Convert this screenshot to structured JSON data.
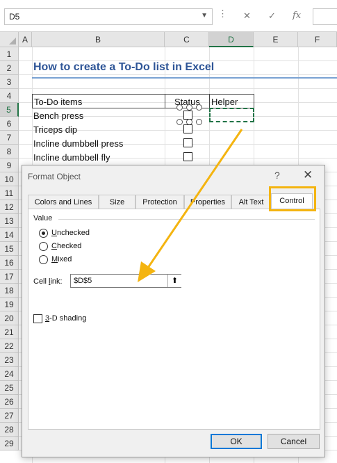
{
  "formula_bar": {
    "name_box": "D5",
    "cancel_glyph": "✕",
    "enter_glyph": "✓",
    "fx_glyph": "fx"
  },
  "columns": [
    "A",
    "B",
    "C",
    "D",
    "E",
    "F"
  ],
  "selected_column": "D",
  "rows": [
    "1",
    "2",
    "3",
    "4",
    "5",
    "6",
    "7",
    "8",
    "9",
    "10",
    "11",
    "12",
    "13",
    "14",
    "15",
    "16",
    "17",
    "18",
    "19",
    "20",
    "21",
    "22",
    "23",
    "24",
    "25",
    "26",
    "27",
    "28",
    "29"
  ],
  "selected_row": "5",
  "sheet": {
    "title": "How to create a To-Do list in Excel",
    "headers": {
      "items": "To-Do items",
      "status": "Status",
      "helper": "Helper"
    },
    "items": [
      "Bench press",
      "Triceps dip",
      "Incline dumbbell press",
      "Incline dumbbell fly"
    ]
  },
  "dialog": {
    "title": "Format Object",
    "help_glyph": "?",
    "close_glyph": "✕",
    "tabs": [
      "Colors and Lines",
      "Size",
      "Protection",
      "Properties",
      "Alt Text",
      "Control"
    ],
    "active_tab": "Control",
    "value_group_label": "Value",
    "radio_options": [
      {
        "first": "U",
        "rest": "nchecked",
        "selected": true
      },
      {
        "first": "C",
        "rest": "hecked",
        "selected": false
      },
      {
        "first": "M",
        "rest": "ixed",
        "selected": false
      }
    ],
    "cell_link_label_first": "Cell ",
    "cell_link_label_underlined": "l",
    "cell_link_label_rest": "ink:",
    "cell_link_value": "$D$5",
    "cell_link_button_glyph": "⬆",
    "shading_first": "3",
    "shading_rest": "-D shading",
    "shading_checked": false,
    "ok_label": "OK",
    "cancel_label": "Cancel"
  },
  "colors": {
    "highlight": "#f4b410",
    "title": "#2e5597",
    "selection": "#217346"
  },
  "icons": [
    "dropdown-arrow-icon",
    "close-icon",
    "check-icon",
    "function-icon",
    "collapse-dialog-icon",
    "annotation-arrow"
  ]
}
